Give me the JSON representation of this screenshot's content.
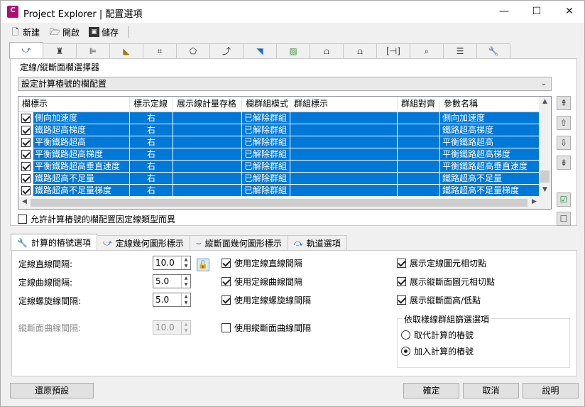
{
  "window": {
    "app_icon_letter": "C",
    "title": "Project Explorer | 配置選項",
    "min_glyph": "—",
    "max_glyph": "☐",
    "close_glyph": "✕"
  },
  "toolbar": {
    "new_label": "新建",
    "open_label": "開啟",
    "save_label": "儲存"
  },
  "icon_tabs": [
    "alignment-curve-icon",
    "corridor-icon",
    "profile-icon",
    "road-icon",
    "frame-icon",
    "surface-icon",
    "curve-arrow-icon",
    "pipe-icon",
    "map-icon",
    "structure-icon",
    "structure2-icon",
    "bracket-icon",
    "view-icon",
    "list-icon",
    "wrench-icon"
  ],
  "selector": {
    "label": "定線/縱斷面欄選擇器",
    "combo_value": "設定計算樁號的欄配置"
  },
  "grid": {
    "headers": [
      "欄標示",
      "標示定線",
      "展示線計量存格",
      "欄群組模式",
      "群組標示",
      "群組對齊",
      "參數名稱"
    ],
    "rows": [
      {
        "checked": true,
        "name": "側向加速度",
        "side": "右",
        "mode": "已解除群組",
        "param": "側向加速度"
      },
      {
        "checked": true,
        "name": "鐵路超高梯度",
        "side": "右",
        "mode": "已解除群組",
        "param": "鐵路超高梯度"
      },
      {
        "checked": true,
        "name": "平衡鐵路超高",
        "side": "右",
        "mode": "已解除群組",
        "param": "平衡鐵路超高"
      },
      {
        "checked": true,
        "name": "平衡鐵路超高梯度",
        "side": "右",
        "mode": "已解除群組",
        "param": "平衡鐵路超高梯度"
      },
      {
        "checked": true,
        "name": "平衡鐵路超高垂直速度",
        "side": "右",
        "mode": "已解除群組",
        "param": "平衡鐵路超高垂直速度"
      },
      {
        "checked": true,
        "name": "鐵路超高不足量",
        "side": "右",
        "mode": "已解除群組",
        "param": "鐵路超高不足量"
      },
      {
        "checked": true,
        "name": "鐵路超高不足量梯度",
        "side": "右",
        "mode": "已解除群組",
        "param": "鐵路超高不足量梯度"
      }
    ]
  },
  "allow_label": "允許計算樁號的欄配置因定線類型而異",
  "bottom_tabs": {
    "calc": "計算的樁號選項",
    "alignment": "定線幾何圖形標示",
    "profile": "縱斷面幾何圖形標示",
    "track": "軌道選項"
  },
  "fields": {
    "straight_label": "定線直線間隔:",
    "straight_value": "10.0",
    "curve_label": "定線曲線間隔:",
    "curve_value": "5.0",
    "spiral_label": "定線螺旋線間隔:",
    "spiral_value": "5.0",
    "profile_label": "縱斷面曲線間隔:",
    "profile_value": "10.0"
  },
  "checks": {
    "use_straight": "使用定線直線間隔",
    "use_curve": "使用定線曲線間隔",
    "use_spiral": "使用定線螺旋線間隔",
    "use_profile": "使用縱斷面曲線間隔",
    "show_align_tangent": "展示定線圖元相切點",
    "show_profile_tangent": "展示縱斷面圖元相切點",
    "show_high_low": "展示縱斷面高/低點"
  },
  "group": {
    "title": "依取樣線群組篩選選項",
    "replace": "取代計算的樁號",
    "add": "加入計算的樁號"
  },
  "footer": {
    "restore": "還原預設",
    "ok": "確定",
    "cancel": "取消",
    "help": "說明"
  }
}
